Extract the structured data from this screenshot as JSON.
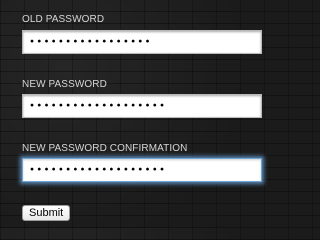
{
  "form": {
    "fields": [
      {
        "label": "OLD PASSWORD",
        "masked_value": "•••••••••••••••••",
        "focused": false
      },
      {
        "label": "NEW PASSWORD",
        "masked_value": "•••••••••••••••••••",
        "focused": false
      },
      {
        "label": "NEW PASSWORD CONFIRMATION",
        "masked_value": "•••••••••••••••••••",
        "focused": true
      }
    ],
    "submit_label": "Submit"
  },
  "colors": {
    "background": "#1e1e1e",
    "label_text": "#d6d6d6",
    "focus_glow": "#6eaae6"
  }
}
